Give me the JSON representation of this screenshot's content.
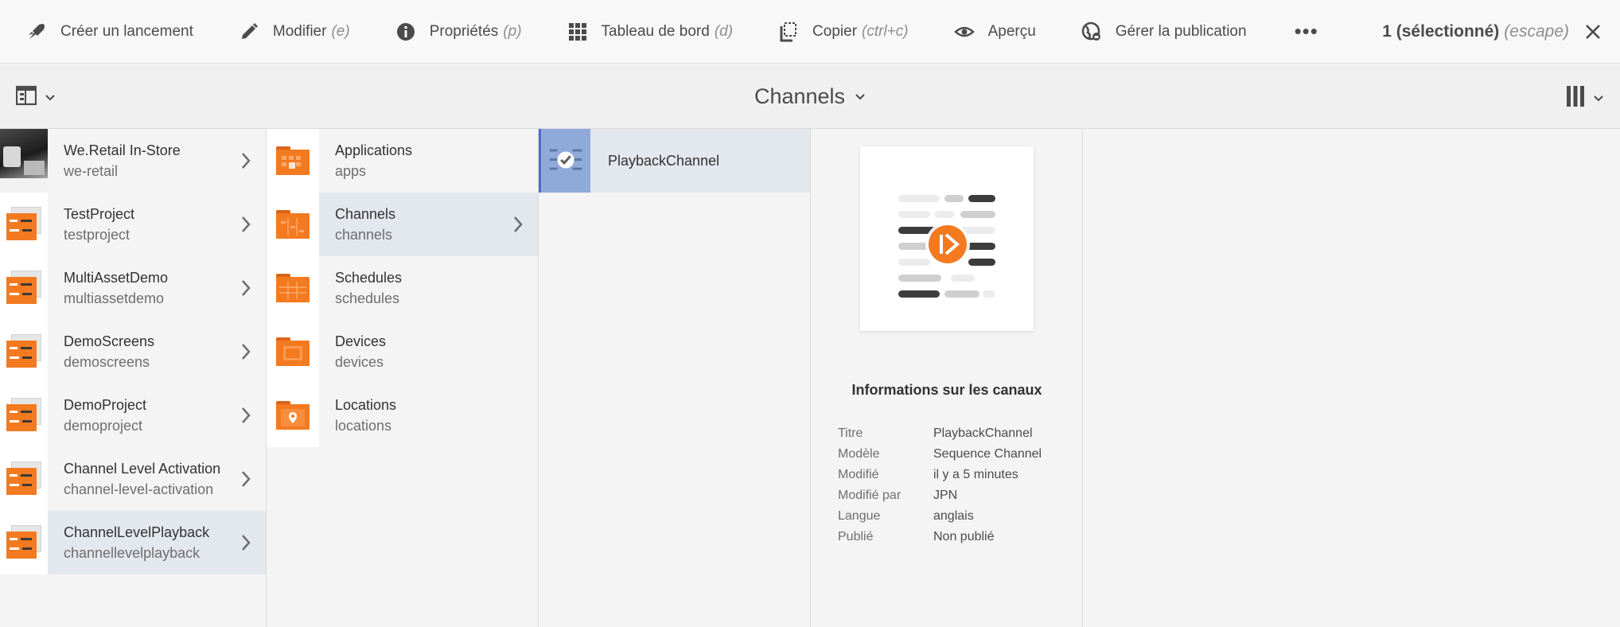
{
  "toolbar": {
    "actions": [
      {
        "label": "Créer un lancement",
        "hint": "",
        "icon": "rocket-icon"
      },
      {
        "label": "Modifier",
        "hint": "(e)",
        "icon": "pencil-icon"
      },
      {
        "label": "Propriétés",
        "hint": "(p)",
        "icon": "info-icon"
      },
      {
        "label": "Tableau de bord",
        "hint": "(d)",
        "icon": "grid-icon"
      },
      {
        "label": "Copier",
        "hint": "(ctrl+c)",
        "icon": "copy-icon"
      },
      {
        "label": "Aperçu",
        "hint": "",
        "icon": "eye-icon"
      },
      {
        "label": "Gérer la publication",
        "hint": "",
        "icon": "globe-icon"
      }
    ],
    "more": "•••",
    "selection_count": "1 (sélectionné)",
    "selection_hint": "(escape)"
  },
  "header": {
    "title": "Channels"
  },
  "projects": [
    {
      "name": "We.Retail In-Store",
      "sub": "we-retail"
    },
    {
      "name": "TestProject",
      "sub": "testproject"
    },
    {
      "name": "MultiAssetDemo",
      "sub": "multiassetdemo"
    },
    {
      "name": "DemoScreens",
      "sub": "demoscreens"
    },
    {
      "name": "DemoProject",
      "sub": "demoproject"
    },
    {
      "name": "Channel Level Activation",
      "sub": "channel-level-activation"
    },
    {
      "name": "ChannelLevelPlayback",
      "sub": "channellevelplayback"
    }
  ],
  "folders": [
    {
      "name": "Applications",
      "sub": "apps"
    },
    {
      "name": "Channels",
      "sub": "channels"
    },
    {
      "name": "Schedules",
      "sub": "schedules"
    },
    {
      "name": "Devices",
      "sub": "devices"
    },
    {
      "name": "Locations",
      "sub": "locations"
    }
  ],
  "channels": [
    {
      "name": "PlaybackChannel"
    }
  ],
  "details": {
    "heading": "Informations sur les canaux",
    "rows": [
      {
        "key": "Titre",
        "value": "PlaybackChannel"
      },
      {
        "key": "Modèle",
        "value": "Sequence Channel"
      },
      {
        "key": "Modifié",
        "value": "il y a 5 minutes"
      },
      {
        "key": "Modifié par",
        "value": "JPN"
      },
      {
        "key": "Langue",
        "value": "anglais"
      },
      {
        "key": "Publié",
        "value": "Non publié"
      }
    ]
  },
  "colors": {
    "accent_orange": "#f47a20",
    "selection_bg": "#e3e7ee",
    "selection_border": "#4a6fc7"
  }
}
